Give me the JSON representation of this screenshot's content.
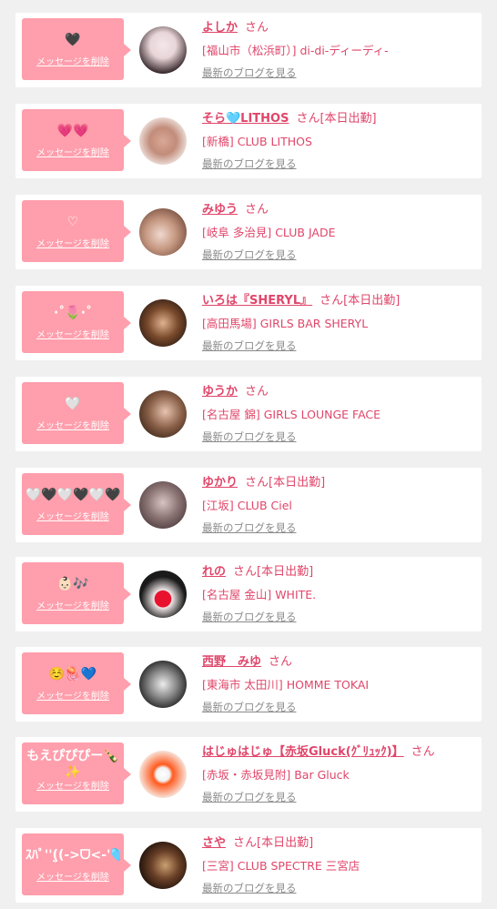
{
  "entries": [
    {
      "message": "🖤",
      "delete_label": "メッセージを削除",
      "name": "よしか",
      "suffix": "さん",
      "shop": "[福山市（松浜町）] di-di-ディーディ-",
      "blog_link": "最新のブログを見る"
    },
    {
      "message": "💗💗",
      "delete_label": "メッセージを削除",
      "name": "そら🩵LITHOS",
      "suffix": "さん[本日出勤]",
      "shop": "[新橋] CLUB LITHOS",
      "blog_link": "最新のブログを見る"
    },
    {
      "message": "♡",
      "delete_label": "メッセージを削除",
      "name": "みゆう",
      "suffix": "さん",
      "shop": "[岐阜 多治見] CLUB JADE",
      "blog_link": "最新のブログを見る"
    },
    {
      "message": "·˚🌷·˚",
      "delete_label": "メッセージを削除",
      "name": "いろは『SHERYL』",
      "suffix": "さん[本日出勤]",
      "shop": "[高田馬場] GIRLS BAR SHERYL",
      "blog_link": "最新のブログを見る"
    },
    {
      "message": "🤍",
      "delete_label": "メッセージを削除",
      "name": "ゆうか",
      "suffix": "さん",
      "shop": "[名古屋 錦] GIRLS LOUNGE FACE",
      "blog_link": "最新のブログを見る"
    },
    {
      "message": "🤍🖤🤍🖤🤍🖤",
      "delete_label": "メッセージを削除",
      "name": "ゆかり",
      "suffix": "さん[本日出勤]",
      "shop": "[江坂] CLUB Ciel",
      "blog_link": "最新のブログを見る"
    },
    {
      "message": "👶🏻🎶",
      "delete_label": "メッセージを削除",
      "name": "れの",
      "suffix": "さん[本日出勤]",
      "shop": "[名古屋 金山] WHITE.",
      "blog_link": "最新のブログを見る"
    },
    {
      "message": "☺️🪼💙",
      "delete_label": "メッセージを削除",
      "name": "西野　みゆ",
      "suffix": "さん",
      "shop": "[東海市 太田川] HOMME TOKAI",
      "blog_link": "最新のブログを見る"
    },
    {
      "message": "もえぴぴぴー🍾✨",
      "delete_label": "メッセージを削除",
      "name": "はじゅはじゅ【赤坂Gluck(ｸﾞﾘｭｯｸ)】",
      "suffix": "さん",
      "shop": "[赤坂・赤坂見附] Bar Gluck",
      "blog_link": "最新のブログを見る"
    },
    {
      "message": "ｽﾊﾟ''(̤̮(->ᗜ<-'🩵",
      "delete_label": "メッセージを削除",
      "name": "さや",
      "suffix": "さん[本日出勤]",
      "shop": "[三宮] CLUB SPECTRE 三宮店",
      "blog_link": "最新のブログを見る"
    }
  ],
  "colors": {
    "accent": "#e0466a",
    "bubble": "#ff9eac",
    "background": "#f0f0f0"
  }
}
